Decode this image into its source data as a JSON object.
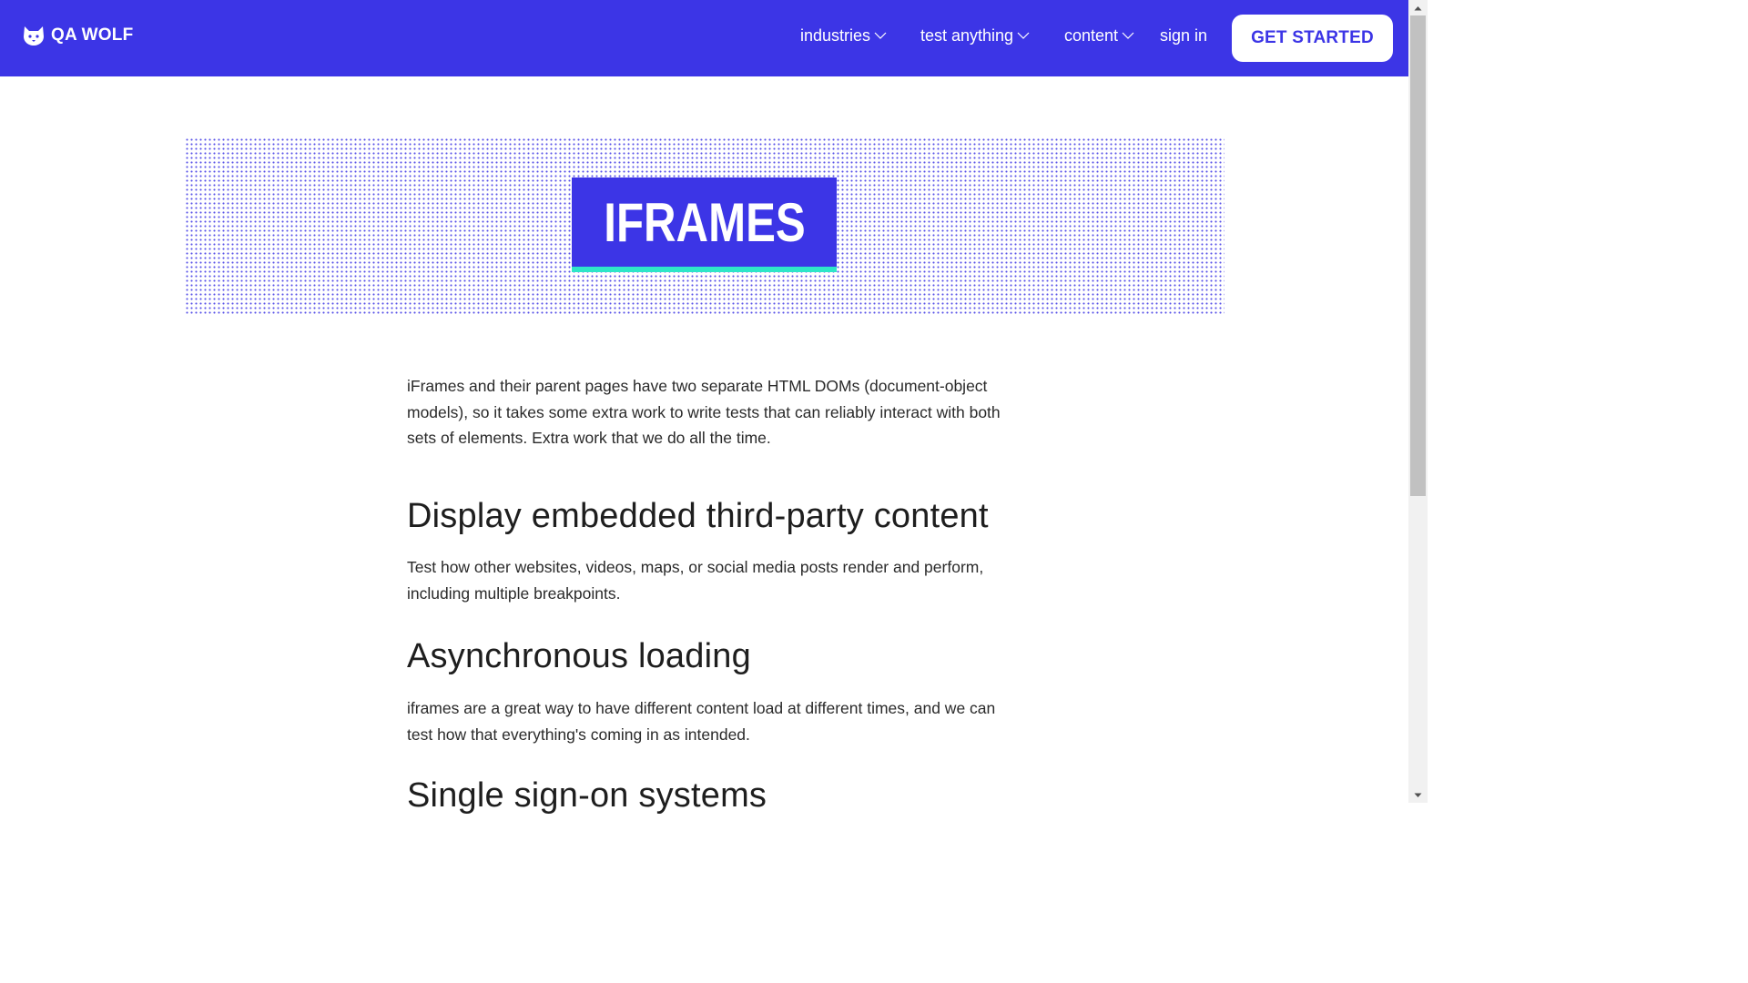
{
  "nav": {
    "logo_text": "QA WOLF",
    "items": [
      {
        "label": "industries",
        "has_dropdown": true
      },
      {
        "label": "test anything",
        "has_dropdown": true
      },
      {
        "label": "content",
        "has_dropdown": true
      },
      {
        "label": "sign in",
        "has_dropdown": false
      }
    ],
    "cta_label": "GET STARTED"
  },
  "hero": {
    "title": "IFRAMES"
  },
  "article": {
    "intro": "iFrames and their parent pages have two separate HTML DOMs (document-object models), so it takes some extra work to write tests that can reliably interact with both sets of elements. Extra work that we do all the time.",
    "sections": [
      {
        "heading": "Display embedded third-party content",
        "body": "Test how other websites, videos, maps, or social media posts render and perform, including multiple breakpoints."
      },
      {
        "heading": "Asynchronous loading",
        "body": "iframes are a great way to have different content load at different times, and we can test how that everything's coming in as intended."
      },
      {
        "heading": "Single sign-on systems",
        "body": ""
      }
    ]
  },
  "colors": {
    "brand": "#3c35e6",
    "accent": "#2ee6c8",
    "text": "#262626"
  },
  "icons": {
    "logo": "wolf-icon",
    "dropdown": "chevron-down-icon"
  }
}
